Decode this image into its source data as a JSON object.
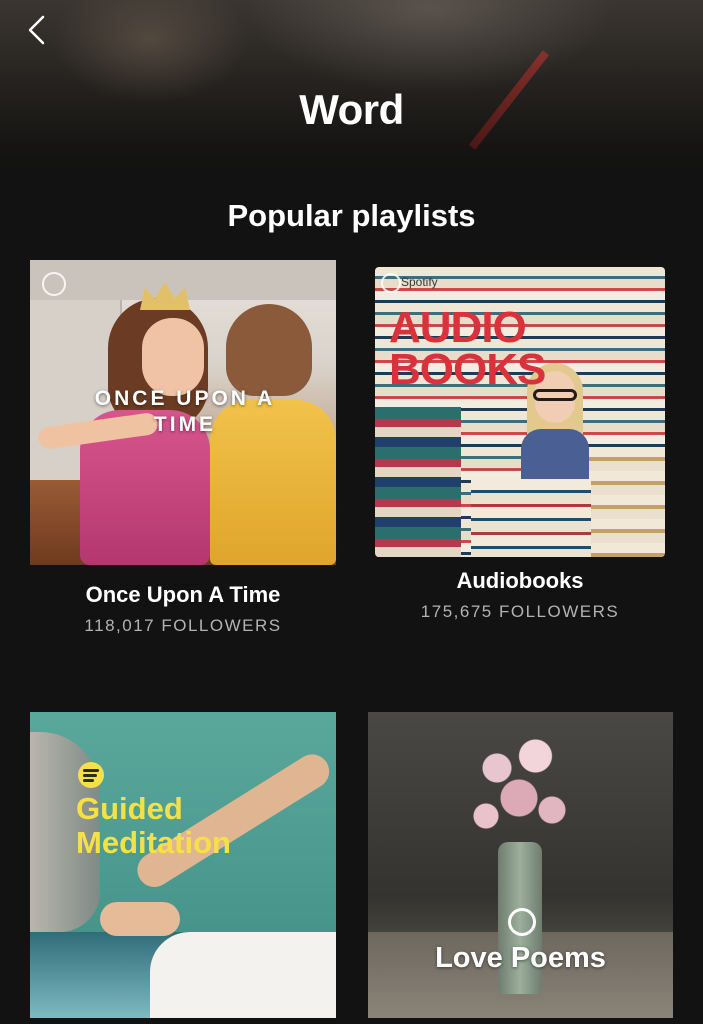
{
  "header": {
    "title": "Word",
    "back_icon": "chevron-left-icon"
  },
  "section": {
    "title": "Popular playlists"
  },
  "playlists": [
    {
      "cover_text": "ONCE UPON A TIME",
      "title": "Once Upon A Time",
      "followers": "118,017 FOLLOWERS"
    },
    {
      "cover_text": "AUDIO BOOKS",
      "cover_badge": "Spotify",
      "title": "Audiobooks",
      "followers": "175,675 FOLLOWERS"
    },
    {
      "cover_text": "Guided Meditation",
      "title": "",
      "followers": ""
    },
    {
      "cover_text": "Love Poems",
      "title": "",
      "followers": ""
    }
  ],
  "colors": {
    "background": "#121212",
    "meditation_yellow": "#f5e147",
    "audiobooks_red": "#d9323c",
    "subtext": "#b3b3b3"
  }
}
